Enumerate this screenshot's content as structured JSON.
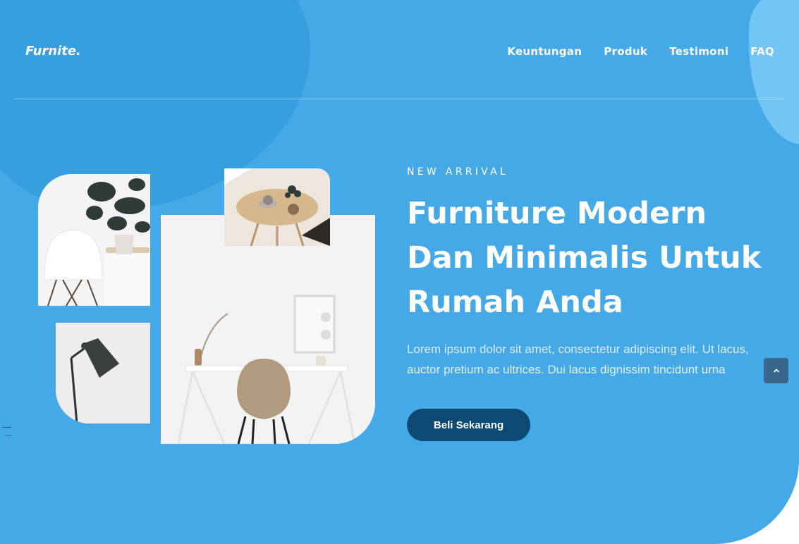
{
  "brand": {
    "logo": "Furnite."
  },
  "nav": {
    "items": [
      {
        "label": "Keuntungan"
      },
      {
        "label": "Produk"
      },
      {
        "label": "Testimoni"
      },
      {
        "label": "FAQ"
      }
    ]
  },
  "hero": {
    "eyebrow": "NEW ARRIVAL",
    "title_lines": [
      "Furniture Modern",
      "Dan Minimalis Untuk",
      "Rumah Anda"
    ],
    "description_lines": [
      "Lorem ipsum dolor sit amet, consectetur adipiscing elit. Ut lacus,",
      "auctor pretium ac ultrices. Dui lacus dignissim tincidunt urna"
    ],
    "cta_label": "Beli Sekarang"
  },
  "icons": {
    "scroll_top": "chevron-up-icon"
  },
  "colors": {
    "hero_background": "#45a9e8",
    "blob_dark": "#379fdd",
    "blob_light": "#72c5f4",
    "cta_background": "#0c4a74",
    "scroll_button": "#37678a"
  }
}
